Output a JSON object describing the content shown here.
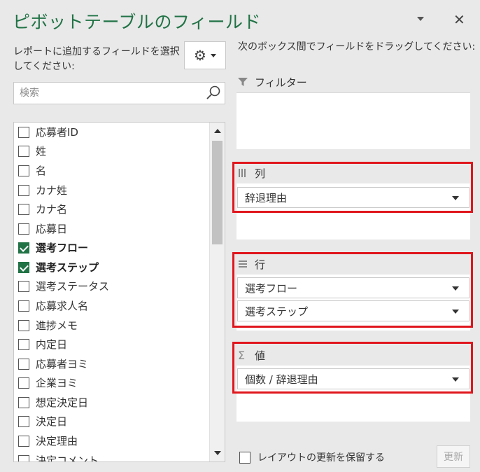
{
  "panel": {
    "title": "ピボットテーブルのフィールド",
    "choose_label": "レポートに追加するフィールドを選択してください:",
    "search_placeholder": "検索",
    "drag_label": "次のボックス間でフィールドをドラッグしてください:"
  },
  "fields": [
    {
      "label": "応募者ID",
      "checked": false
    },
    {
      "label": "姓",
      "checked": false
    },
    {
      "label": "名",
      "checked": false
    },
    {
      "label": "カナ姓",
      "checked": false
    },
    {
      "label": "カナ名",
      "checked": false
    },
    {
      "label": "応募日",
      "checked": false
    },
    {
      "label": "選考フロー",
      "checked": true
    },
    {
      "label": "選考ステップ",
      "checked": true
    },
    {
      "label": "選考ステータス",
      "checked": false
    },
    {
      "label": "応募求人名",
      "checked": false
    },
    {
      "label": "進捗メモ",
      "checked": false
    },
    {
      "label": "内定日",
      "checked": false
    },
    {
      "label": "応募者ヨミ",
      "checked": false
    },
    {
      "label": "企業ヨミ",
      "checked": false
    },
    {
      "label": "想定決定日",
      "checked": false
    },
    {
      "label": "決定日",
      "checked": false
    },
    {
      "label": "決定理由",
      "checked": false
    },
    {
      "label": "決定コメント",
      "checked": false
    }
  ],
  "areas": {
    "filter": {
      "label": "フィルター",
      "icon": "filter-icon"
    },
    "columns": {
      "label": "列",
      "icon": "columns-icon",
      "items": [
        "辞退理由"
      ]
    },
    "rows": {
      "label": "行",
      "icon": "rows-icon",
      "items": [
        "選考フロー",
        "選考ステップ"
      ]
    },
    "values": {
      "label": "値",
      "icon": "sigma-icon",
      "items": [
        "個数 / 辞退理由"
      ]
    }
  },
  "footer": {
    "defer_label": "レイアウトの更新を保留する",
    "update_label": "更新"
  },
  "colors": {
    "title": "#217346",
    "checkbox_checked": "#217346",
    "highlight_frame": "#e0161d"
  }
}
